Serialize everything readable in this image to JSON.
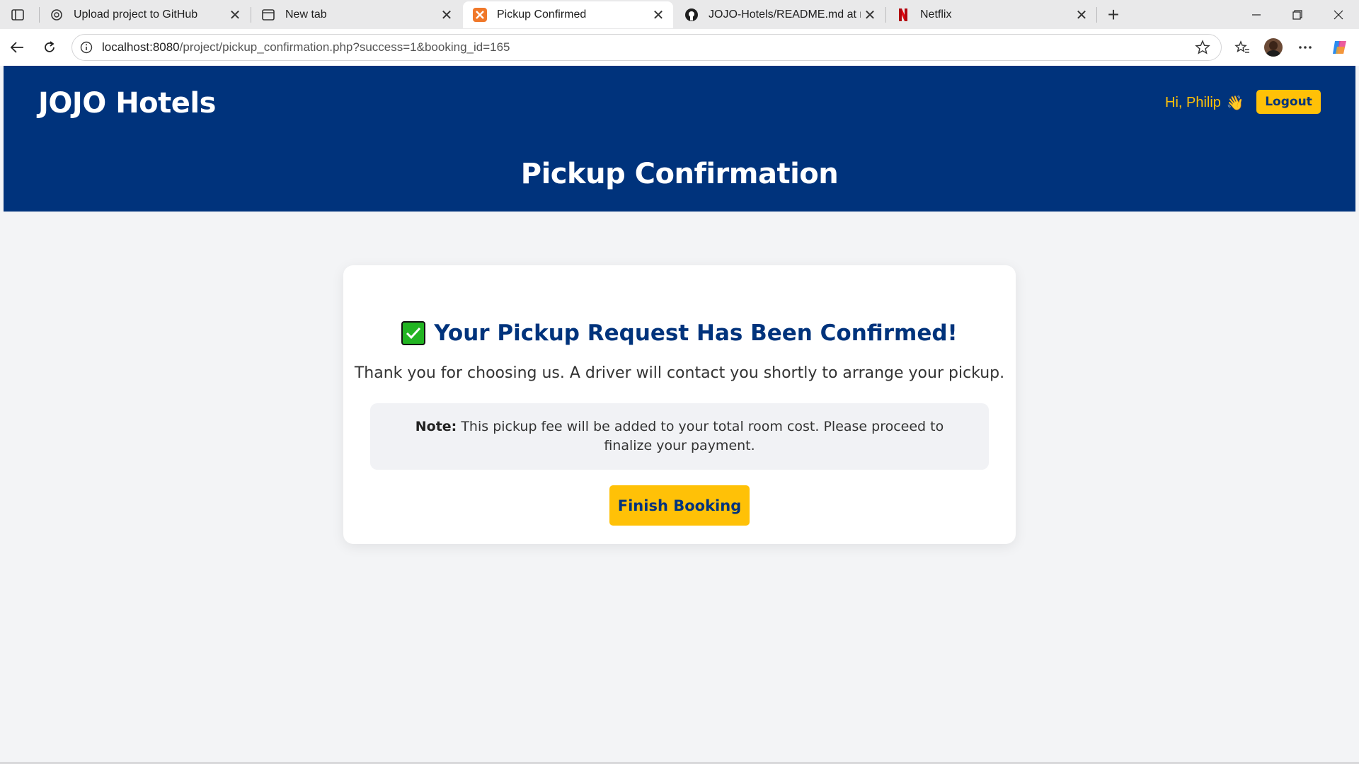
{
  "browser": {
    "tabs": [
      {
        "title": "Upload project to GitHub",
        "icon": "chatgpt-icon"
      },
      {
        "title": "New tab",
        "icon": "newtab-icon"
      },
      {
        "title": "Pickup Confirmed",
        "icon": "xampp-icon",
        "active": true
      },
      {
        "title": "JOJO-Hotels/README.md at main",
        "icon": "github-icon"
      },
      {
        "title": "Netflix",
        "icon": "netflix-icon"
      }
    ],
    "url_host": "localhost:8080",
    "url_path": "/project/pickup_confirmation.php?success=1&booking_id=165",
    "colors": {
      "tabbar": "#e9e9ea",
      "active_tab": "#ffffff"
    }
  },
  "header": {
    "brand": "JOJO Hotels",
    "greeting": "Hi, Philip",
    "greeting_emoji": "👋",
    "logout_label": "Logout",
    "page_title": "Pickup Confirmation"
  },
  "card": {
    "heading": "Your Pickup Request Has Been Confirmed!",
    "message": "Thank you for choosing us. A driver will contact you shortly to arrange your pickup.",
    "note_label": "Note:",
    "note_text": "This pickup fee will be added to your total room cost. Please proceed to finalize your payment.",
    "button_label": "Finish Booking"
  },
  "colors": {
    "brand_blue": "#00337c",
    "accent_yellow": "#ffc107",
    "page_bg": "#f3f4f6",
    "check_green": "#22b422"
  }
}
